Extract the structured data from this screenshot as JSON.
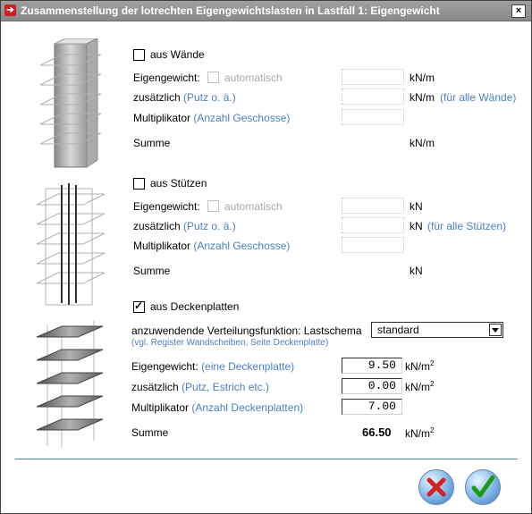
{
  "window": {
    "title": "Zusammenstellung der lotrechten Eigengewichtslasten in Lastfall 1: Eigengewicht",
    "close_label": "×"
  },
  "walls": {
    "checkbox_label": "aus Wände",
    "checked": false,
    "eigengewicht_label": "Eigengewicht:",
    "automatisch_label": "automatisch",
    "eigengewicht_unit": "kN/m",
    "zusaetzlich_label": "zusätzlich",
    "zusaetzlich_hint": "(Putz o. ä.)",
    "zusaetzlich_unit": "kN/m",
    "zusaetzlich_note": "(für alle Wände)",
    "multiplikator_label": "Multiplikator",
    "multiplikator_hint": "(Anzahl Geschosse)",
    "summe_label": "Summe",
    "summe_unit": "kN/m"
  },
  "columns": {
    "checkbox_label": "aus Stützen",
    "checked": false,
    "eigengewicht_label": "Eigengewicht:",
    "automatisch_label": "automatisch",
    "eigengewicht_unit": "kN",
    "zusaetzlich_label": "zusätzlich",
    "zusaetzlich_hint": "(Putz o. ä.)",
    "zusaetzlich_unit": "kN",
    "zusaetzlich_note": "(für alle Stützen)",
    "multiplikator_label": "Multiplikator",
    "multiplikator_hint": "(Anzahl Geschosse)",
    "summe_label": "Summe",
    "summe_unit": "kN"
  },
  "slabs": {
    "checkbox_label": "aus Deckenplatten",
    "checked": true,
    "verteilung_label": "anzuwendende Verteilungsfunktion: Lastschema",
    "verteilung_value": "standard",
    "verteilung_note": "(vgl. Register Wandscheiben, Seite Deckenplatte)",
    "eigengewicht_label": "Eigengewicht:",
    "eigengewicht_hint": "(eine Deckenplatte)",
    "eigengewicht_value": "9.50",
    "zusaetzlich_label": "zusätzlich",
    "zusaetzlich_hint": "(Putz, Estrich etc.)",
    "zusaetzlich_value": "0.00",
    "multiplikator_label": "Multiplikator",
    "multiplikator_hint": "(Anzahl Deckenplatten)",
    "multiplikator_value": "7.00",
    "unit": "kN/m",
    "unit_sup": "2",
    "summe_label": "Summe",
    "summe_value": "66.50"
  },
  "buttons": {
    "cancel_icon": "cancel-x-icon",
    "ok_icon": "checkmark-icon"
  }
}
